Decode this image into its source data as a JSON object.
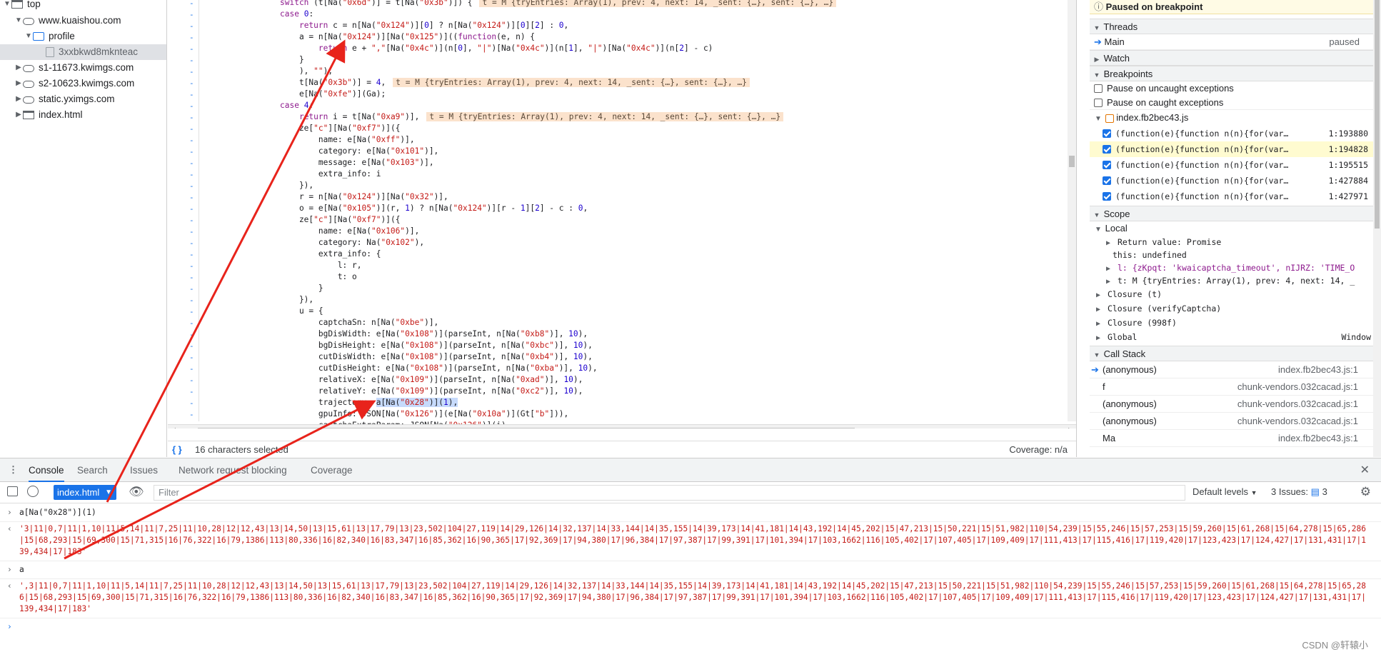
{
  "navigator": {
    "items": [
      {
        "label": "top",
        "depth": 0,
        "type": "page"
      },
      {
        "label": "www.kuaishou.com",
        "depth": 1,
        "type": "cloud"
      },
      {
        "label": "profile",
        "depth": 2,
        "type": "folder"
      },
      {
        "label": "3xxbkwd8mknteac",
        "depth": 3,
        "type": "file"
      },
      {
        "label": "s1-11673.kwimgs.com",
        "depth": 1,
        "type": "cloud"
      },
      {
        "label": "s2-10623.kwimgs.com",
        "depth": 1,
        "type": "cloud"
      },
      {
        "label": "static.yximgs.com",
        "depth": 1,
        "type": "cloud"
      },
      {
        "label": "index.html",
        "depth": 1,
        "type": "page"
      }
    ]
  },
  "editor": {
    "lines": [
      "switch (t[Na(\"0x6d\")] = t[Na(\"0x3b\")]) {",
      "case 0:",
      "    return c = n[Na(\"0x124\")][0] ? n[Na(\"0x124\")][0][2] : 0,",
      "    a = n[Na(\"0x124\")][Na(\"0x125\")]((function(e, n) {",
      "        return e + \",\"[Na(\"0x4c\")](n[0], \"|\")[Na(\"0x4c\")](n[1], \"|\")[Na(\"0x4c\")](n[2] - c)",
      "    }",
      "    ), \"\"),",
      "    t[Na(\"0x3b\")] = 4,",
      "    e[Na(\"0xfe\")](Ga);",
      "case 4:",
      "    return i = t[Na(\"0xa9\")],",
      "    ze[\"c\"][Na(\"0xf7\")]({",
      "        name: e[Na(\"0xff\")],",
      "        category: e[Na(\"0x101\")],",
      "        message: e[Na(\"0x103\")],",
      "        extra_info: i",
      "    }),",
      "    r = n[Na(\"0x124\")][Na(\"0x32\")],",
      "    o = e[Na(\"0x105\")](r, 1) ? n[Na(\"0x124\")][r - 1][2] - c : 0,",
      "    ze[\"c\"][Na(\"0xf7\")]({",
      "        name: e[Na(\"0x106\")],",
      "        category: Na(\"0x102\"),",
      "        extra_info: {",
      "            l: r,",
      "            t: o",
      "        }",
      "    }),",
      "    u = {",
      "        captchaSn: n[Na(\"0xbe\")],",
      "        bgDisWidth: e[Na(\"0x108\")](parseInt, n[Na(\"0xb8\")], 10),",
      "        bgDisHeight: e[Na(\"0x108\")](parseInt, n[Na(\"0xbc\")], 10),",
      "        cutDisWidth: e[Na(\"0x108\")](parseInt, n[Na(\"0xb4\")], 10),",
      "        cutDisHeight: e[Na(\"0x108\")](parseInt, n[Na(\"0xba\")], 10),",
      "        relativeX: e[Na(\"0x109\")](parseInt, n[Na(\"0xad\")], 10),",
      "        relativeY: e[Na(\"0x109\")](parseInt, n[Na(\"0xc2\")], 10),",
      "        trajectory: a[Na(\"0x28\")](1),",
      "        gpuInfo: JSON[Na(\"0x126\")](e[Na(\"0x10a\")](Gt[\"b\"])),",
      "        captchaExtraParam: JSON[Na(\"0x126\")](i)"
    ],
    "inline_values": {
      "line0": "t = M {tryEntries: Array(1), prev: 4, next: 14, _sent: {…}, sent: {…}, …}",
      "line7": "t = M {tryEntries: Array(1), prev: 4, next: 14, _sent: {…}, sent: {…}, …}",
      "line10": "t = M {tryEntries: Array(1), prev: 4, next: 14, _sent: {…}, sent: {…}, …}"
    },
    "highlight": "a[Na(\"0x28\")](1)",
    "status_left": "16 characters selected",
    "status_right": "Coverage: n/a",
    "format_icon": "{ }"
  },
  "sidebar": {
    "banner": "Paused on breakpoint",
    "threads_title": "Threads",
    "thread_name": "Main",
    "thread_state": "paused",
    "watch_title": "Watch",
    "breakpoints_title": "Breakpoints",
    "pause_uncaught": "Pause on uncaught exceptions",
    "pause_caught": "Pause on caught exceptions",
    "bp_file": "index.fb2bec43.js",
    "breakpoints": [
      {
        "code": "(function(e){function n(n){for(var…",
        "loc": "1:193880",
        "current": false
      },
      {
        "code": "(function(e){function n(n){for(var…",
        "loc": "1:194828",
        "current": true
      },
      {
        "code": "(function(e){function n(n){for(var…",
        "loc": "1:195515",
        "current": false
      },
      {
        "code": "(function(e){function n(n){for(var…",
        "loc": "1:427884",
        "current": false
      },
      {
        "code": "(function(e){function n(n){for(var…",
        "loc": "1:427971",
        "current": false
      }
    ],
    "scope_title": "Scope",
    "local_title": "Local",
    "scope_rows": [
      "Return value: Promise",
      "this: undefined",
      "l: {zKpqt: 'kwaicaptcha_timeout', nIJRZ: 'TIME_O",
      "t: M {tryEntries: Array(1), prev: 4, next: 14, _"
    ],
    "closures": [
      "Closure (t)",
      "Closure (verifyCaptcha)",
      "Closure (998f)"
    ],
    "global_label": "Global",
    "global_value": "Window",
    "callstack_title": "Call Stack",
    "callstack": [
      {
        "fn": "(anonymous)",
        "loc": "index.fb2bec43.js:1"
      },
      {
        "fn": "f",
        "loc": "chunk-vendors.032cacad.js:1"
      },
      {
        "fn": "(anonymous)",
        "loc": "chunk-vendors.032cacad.js:1"
      },
      {
        "fn": "(anonymous)",
        "loc": "chunk-vendors.032cacad.js:1"
      },
      {
        "fn": "Ma",
        "loc": "index.fb2bec43.js:1"
      }
    ]
  },
  "drawer": {
    "tabs": [
      "Console",
      "Search",
      "Issues",
      "Network request blocking",
      "Coverage"
    ],
    "context": "index.html",
    "filter_placeholder": "Filter",
    "levels": "Default levels",
    "issues_label": "3 Issues:",
    "issues_count": "3",
    "console": [
      {
        "type": "input",
        "text": "a[Na(\"0x28\")](1)"
      },
      {
        "type": "output",
        "text": "'3|11|0,7|11|1,10|11|5,14|11|7,25|11|10,28|12|12,43|13|14,50|13|15,61|13|17,79|13|23,502|104|27,119|14|29,126|14|32,137|14|33,144|14|35,155|14|39,173|14|41,181|14|43,192|14|45,202|15|47,213|15|50,221|15|51,982|110|54,239|15|55,246|15|57,253|15|59,260|15|61,268|15|64,278|15|65,286|15|68,293|15|69,300|15|71,315|16|76,322|16|79,1386|113|80,336|16|82,340|16|83,347|16|85,362|16|90,365|17|92,369|17|94,380|17|96,384|17|97,387|17|99,391|17|101,394|17|103,1662|116|105,402|17|107,405|17|109,409|17|111,413|17|115,416|17|119,420|17|123,423|17|124,427|17|131,431|17|139,434|17|183'"
      },
      {
        "type": "input",
        "text": "a"
      },
      {
        "type": "output",
        "text": "',3|11|0,7|11|1,10|11|5,14|11|7,25|11|10,28|12|12,43|13|14,50|13|15,61|13|17,79|13|23,502|104|27,119|14|29,126|14|32,137|14|33,144|14|35,155|14|39,173|14|41,181|14|43,192|14|45,202|15|47,213|15|50,221|15|51,982|110|54,239|15|55,246|15|57,253|15|59,260|15|61,268|15|64,278|15|65,286|15|68,293|15|69,300|15|71,315|16|76,322|16|79,1386|113|80,336|16|82,340|16|83,347|16|85,362|16|90,365|17|92,369|17|94,380|17|96,384|17|97,387|17|99,391|17|101,394|17|103,1662|116|105,402|17|107,405|17|109,409|17|111,413|17|115,416|17|119,420|17|123,423|17|124,427|17|131,431|17|139,434|17|183'"
      }
    ]
  },
  "watermark": "CSDN @轩辕小",
  "colors": {
    "accent": "#1a73e8",
    "annotation_arrow": "#e8231b",
    "string": "#c41a16"
  }
}
